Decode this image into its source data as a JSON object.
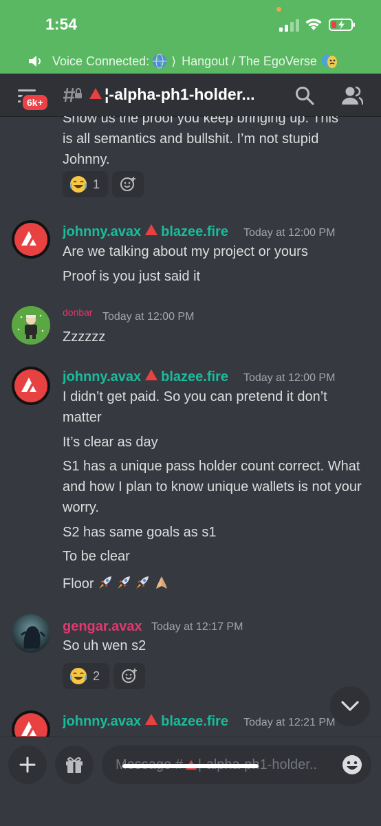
{
  "status_bar": {
    "time": "1:54",
    "voice_prefix": "Voice Connected:",
    "voice_channel": "Hangout / The EgoVerse"
  },
  "header": {
    "mention_badge": "6k+",
    "channel_name": "¦-alpha-ph1-holder..."
  },
  "prev_message": {
    "text": "Show us the proof you keep bringing up. This is all semantics and bullshit. I’m not stupid Johnny.",
    "reaction_count": "1"
  },
  "messages": [
    {
      "author": "johnny.avax",
      "author_suffix": "blazee.fire",
      "timestamp": "Today at 12:00 PM",
      "lines": [
        "Are we talking about my project or yours",
        "Proof is you just said it"
      ]
    },
    {
      "author": "donbar",
      "timestamp": "Today at 12:00 PM",
      "lines": [
        "Zzzzzz"
      ]
    },
    {
      "author": "johnny.avax",
      "author_suffix": "blazee.fire",
      "timestamp": "Today at 12:00 PM",
      "lines": [
        "I didn’t get paid. So you can pretend it don’t matter",
        "It’s clear as day",
        "S1 has a unique pass holder count correct. What and how I plan to know unique wallets is not your worry.",
        "S2 has same goals as s1",
        "To be clear",
        "Floor"
      ]
    },
    {
      "author": "gengar.avax",
      "timestamp": "Today at 12:17 PM",
      "lines": [
        "So uh wen s2"
      ],
      "reaction_count": "2"
    },
    {
      "author": "johnny.avax",
      "author_suffix": "blazee.fire",
      "timestamp": "Today at 12:21 PM",
      "lines": []
    }
  ],
  "composer": {
    "placeholder": "Message #",
    "placeholder_channel": "¦-alpha-ph1-holder.."
  },
  "colors": {
    "status_bar": "#5ab863",
    "background": "#36393f",
    "header": "#2f3136",
    "username_teal": "#1abc9c",
    "username_pink": "#e2386e",
    "avax_red": "#e84142"
  }
}
